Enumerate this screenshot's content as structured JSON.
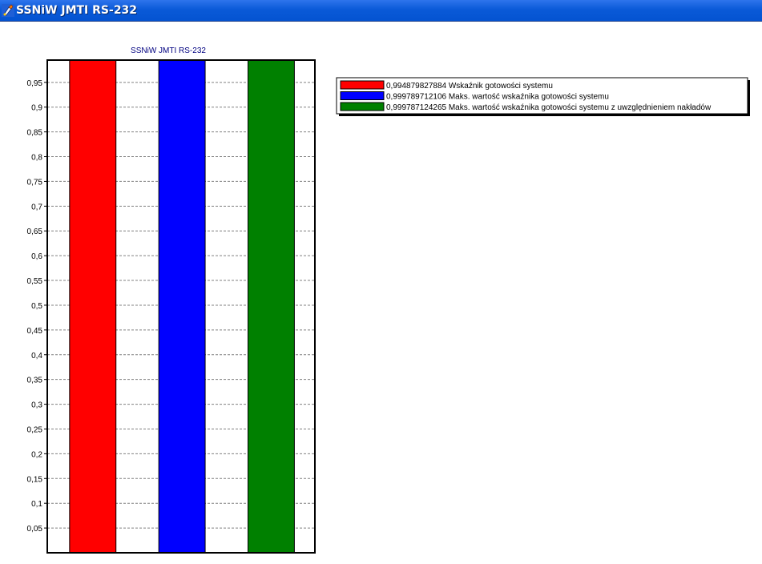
{
  "window": {
    "title": "SSNiW JMTI RS-232"
  },
  "chart_data": {
    "type": "bar",
    "title": "SSNiW JMTI RS-232",
    "ylim": [
      0,
      0.995
    ],
    "yticks": [
      "0,05",
      "0,1",
      "0,15",
      "0,2",
      "0,25",
      "0,3",
      "0,35",
      "0,4",
      "0,45",
      "0,5",
      "0,55",
      "0,6",
      "0,65",
      "0,7",
      "0,75",
      "0,8",
      "0,85",
      "0,9",
      "0,95"
    ],
    "grid": true,
    "legend_position": "right",
    "series": [
      {
        "name": "0,994879827884 Wskaźnik gotowości systemu",
        "value": 0.994879827884,
        "color": "#ff0000"
      },
      {
        "name": "0,999789712106 Maks. wartość wskaźnika gotowości systemu",
        "value": 0.999789712106,
        "color": "#0000ff"
      },
      {
        "name": "0,999787124265 Maks. wartość wskaźnika gotowości systemu z uwzględnieniem nakładów",
        "value": 0.999787124265,
        "color": "#008000"
      }
    ]
  }
}
